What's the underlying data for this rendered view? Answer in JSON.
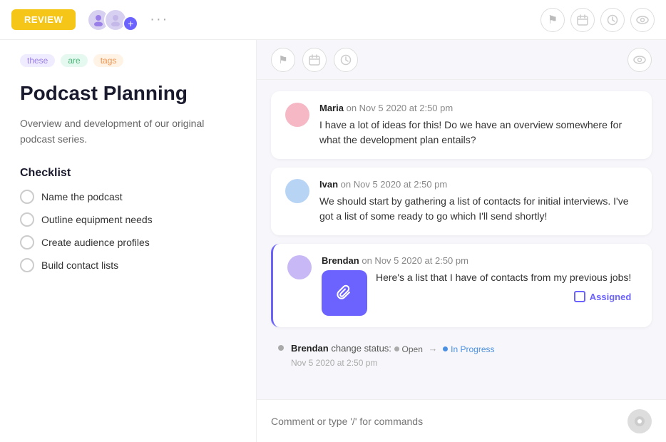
{
  "topbar": {
    "review_label": "REVIEW",
    "dots": "···",
    "icons": {
      "flag": "⚑",
      "calendar": "▭",
      "clock": "○",
      "eye": "◎"
    }
  },
  "left": {
    "tags": [
      {
        "id": "tag-these",
        "label": "these",
        "style": "purple"
      },
      {
        "id": "tag-are",
        "label": "are",
        "style": "green"
      },
      {
        "id": "tag-tags",
        "label": "tags",
        "style": "orange"
      }
    ],
    "title": "Podcast Planning",
    "description": "Overview and development of our original podcast series.",
    "checklist_title": "Checklist",
    "checklist": [
      {
        "id": "item-1",
        "label": "Name the podcast"
      },
      {
        "id": "item-2",
        "label": "Outline equipment needs"
      },
      {
        "id": "item-3",
        "label": "Create audience profiles"
      },
      {
        "id": "item-4",
        "label": "Build contact lists"
      }
    ]
  },
  "comments": [
    {
      "id": "comment-maria",
      "author": "Maria",
      "timestamp": "on Nov 5 2020 at 2:50 pm",
      "text": "I have a lot of ideas for this! Do we have an overview somewhere for what the development plan entails?",
      "avatar_color": "maria"
    },
    {
      "id": "comment-ivan",
      "author": "Ivan",
      "timestamp": "on Nov 5 2020 at 2:50 pm",
      "text": "We should start by gathering a list of contacts for initial interviews. I've got a list of some ready to go which I'll send shortly!",
      "avatar_color": "ivan"
    },
    {
      "id": "comment-brendan",
      "author": "Brendan",
      "timestamp": "on Nov 5 2020 at 2:50 pm",
      "text": "Here's a list that I have of contacts from my previous jobs!",
      "avatar_color": "brendan",
      "has_attachment": true,
      "assigned_label": "Assigned"
    }
  ],
  "status_change": {
    "author": "Brendan",
    "action": "change status:",
    "from": "Open",
    "to": "In Progress",
    "timestamp": "Nov 5 2020 at 2:50 pm"
  },
  "comment_input": {
    "placeholder": "Comment or type '/' for commands"
  }
}
